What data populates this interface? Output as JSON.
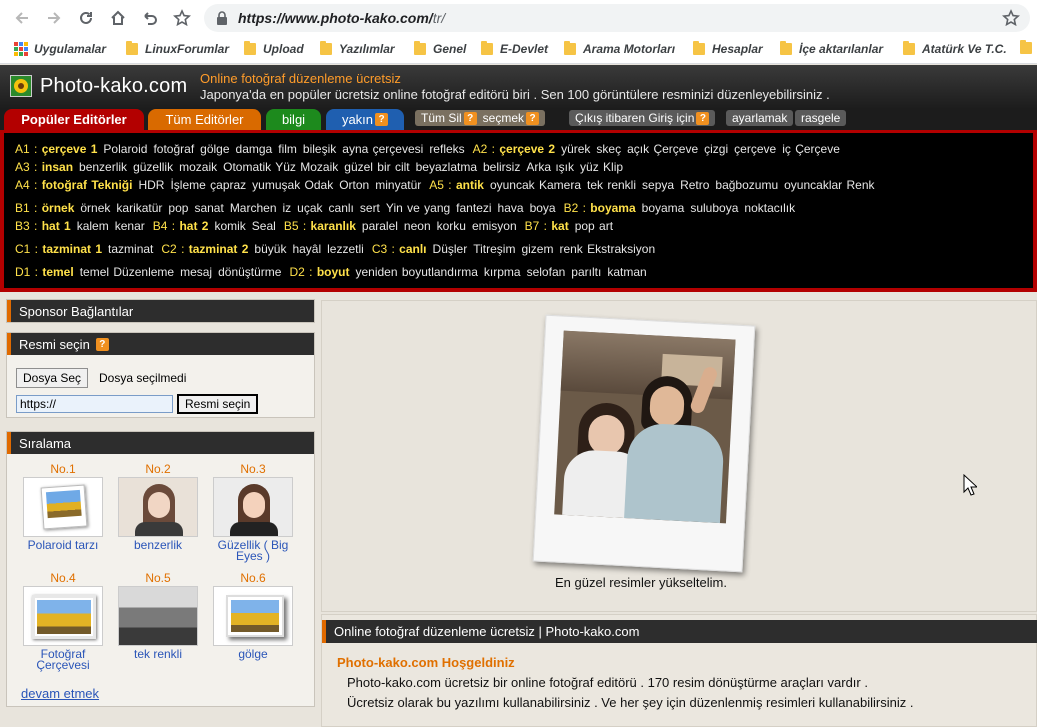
{
  "browser": {
    "url_host": "https://www.photo-kako.com/",
    "url_path": "tr/",
    "bookmarks": [
      "Uygulamalar",
      "LinuxForumlar",
      "Upload",
      "Yazılımlar",
      "Genel",
      "E-Devlet",
      "Arama Motorları",
      "Hesaplar",
      "İçe aktarılanlar",
      "Atatürk Ve T.C."
    ]
  },
  "site": {
    "logo": "Photo-kako.com",
    "tagline1": "Online fotoğraf düzenleme ücretsiz",
    "tagline2": "Japonya'da en popüler ücretsiz online fotoğraf editörü biri . Sen 100 görüntülere resminizi düzenleyebilirsiniz ."
  },
  "tabs": {
    "popular": "Popüler Editörler",
    "all": "Tüm Editörler",
    "info": "bilgi",
    "near": "yakın",
    "clear_all": "Tüm Sil",
    "choose": "seçmek",
    "logout": "Çıkış itibaren Giriş için",
    "settings": "ayarlamak",
    "random": "rasgele",
    "q": "?"
  },
  "editors": {
    "row1": [
      {
        "code": "A1 :",
        "hl": "çerçeve 1",
        "items": [
          "Polaroid",
          "fotoğraf",
          "gölge",
          "damga",
          "film",
          "bileşik",
          "ayna çerçevesi",
          "refleks"
        ]
      },
      {
        "code": "A2 :",
        "hl": "çerçeve 2",
        "items": [
          "yürek",
          "skeç",
          "açık Çerçeve",
          "çizgi",
          "çerçeve",
          "iç Çerçeve"
        ]
      }
    ],
    "row2": [
      {
        "code": "A3 :",
        "hl": "insan",
        "items": [
          "benzerlik",
          "güzellik",
          "mozaik",
          "Otomatik Yüz Mozaik",
          "güzel bir cilt",
          "beyazlatma",
          "belirsiz",
          "Arka ışık",
          "yüz Klip"
        ]
      }
    ],
    "row3": [
      {
        "code": "A4 :",
        "hl": "fotoğraf Tekniği",
        "items": [
          "HDR",
          "İşleme çapraz",
          "yumuşak Odak",
          "Orton",
          "minyatür"
        ]
      },
      {
        "code": "A5 :",
        "hl": "antik",
        "items": [
          "oyuncak Kamera",
          "tek renkli",
          "sepya",
          "Retro",
          "bağbozumu",
          "oyuncaklar Renk"
        ]
      }
    ],
    "row4": [
      {
        "code": "B1 :",
        "hl": "örnek",
        "items": [
          "örnek",
          "karikatür",
          "pop",
          "sanat",
          "Marchen",
          "iz",
          "uçak",
          "canlı",
          "sert",
          "Yin ve yang",
          "fantezi",
          "hava",
          "boya"
        ]
      },
      {
        "code": "B2 :",
        "hl": "boyama",
        "items": [
          "boyama",
          "suluboya",
          "noktacılık"
        ]
      }
    ],
    "row5": [
      {
        "code": "B3 :",
        "hl": "hat 1",
        "items": [
          "kalem",
          "kenar"
        ]
      },
      {
        "code": "B4 :",
        "hl": "hat 2",
        "items": [
          "komik",
          "Seal"
        ]
      },
      {
        "code": "B5 :",
        "hl": "karanlık",
        "items": [
          "paralel",
          "neon",
          "korku",
          "emisyon"
        ]
      },
      {
        "code": "B7 :",
        "hl": "kat",
        "items": [
          "pop art"
        ]
      }
    ],
    "row6": [
      {
        "code": "C1 :",
        "hl": "tazminat 1",
        "items": [
          "tazminat"
        ]
      },
      {
        "code": "C2 :",
        "hl": "tazminat 2",
        "items": [
          "büyük",
          "hayâl",
          "lezzetli"
        ]
      },
      {
        "code": "C3 :",
        "hl": "canlı",
        "items": [
          "Düşler",
          "Titreşim",
          "gizem",
          "renk Ekstraksiyon"
        ]
      }
    ],
    "row7": [
      {
        "code": "D1 :",
        "hl": "temel",
        "items": [
          "temel Düzenleme",
          "mesaj",
          "dönüştürme"
        ]
      },
      {
        "code": "D2 :",
        "hl": "boyut",
        "items": [
          "yeniden boyutlandırma",
          "kırpma",
          "selofan",
          "parıltı",
          "katman"
        ]
      }
    ]
  },
  "left": {
    "sponsor": "Sponsor Bağlantılar",
    "select_title": "Resmi seçin",
    "file_button": "Dosya Seç",
    "file_status": "Dosya seçilmedi",
    "url_value": "https://",
    "select_button": "Resmi seçin",
    "ranking_title": "Sıralama",
    "ranks": [
      {
        "no": "No.1",
        "name": "Polaroid tarzı"
      },
      {
        "no": "No.2",
        "name": "benzerlik"
      },
      {
        "no": "No.3",
        "name": "Güzellik ( Big Eyes )"
      },
      {
        "no": "No.4",
        "name": "Fotoğraf Çerçevesi"
      },
      {
        "no": "No.5",
        "name": "tek renkli"
      },
      {
        "no": "No.6",
        "name": "gölge"
      }
    ],
    "more": "devam etmek"
  },
  "right": {
    "caption": "En güzel resimler yükseltelim.",
    "section_title": "Online fotoğraf düzenleme ücretsiz | Photo-kako.com",
    "welcome": "Photo-kako.com Hoşgeldiniz",
    "p1": "Photo-kako.com ücretsiz bir online fotoğraf editörü . 170 resim dönüştürme araçları vardır .",
    "p2": "Ücretsiz olarak bu yazılımı kullanabilirsiniz . Ve her şey için düzenlenmiş resimleri kullanabilirsiniz ."
  }
}
